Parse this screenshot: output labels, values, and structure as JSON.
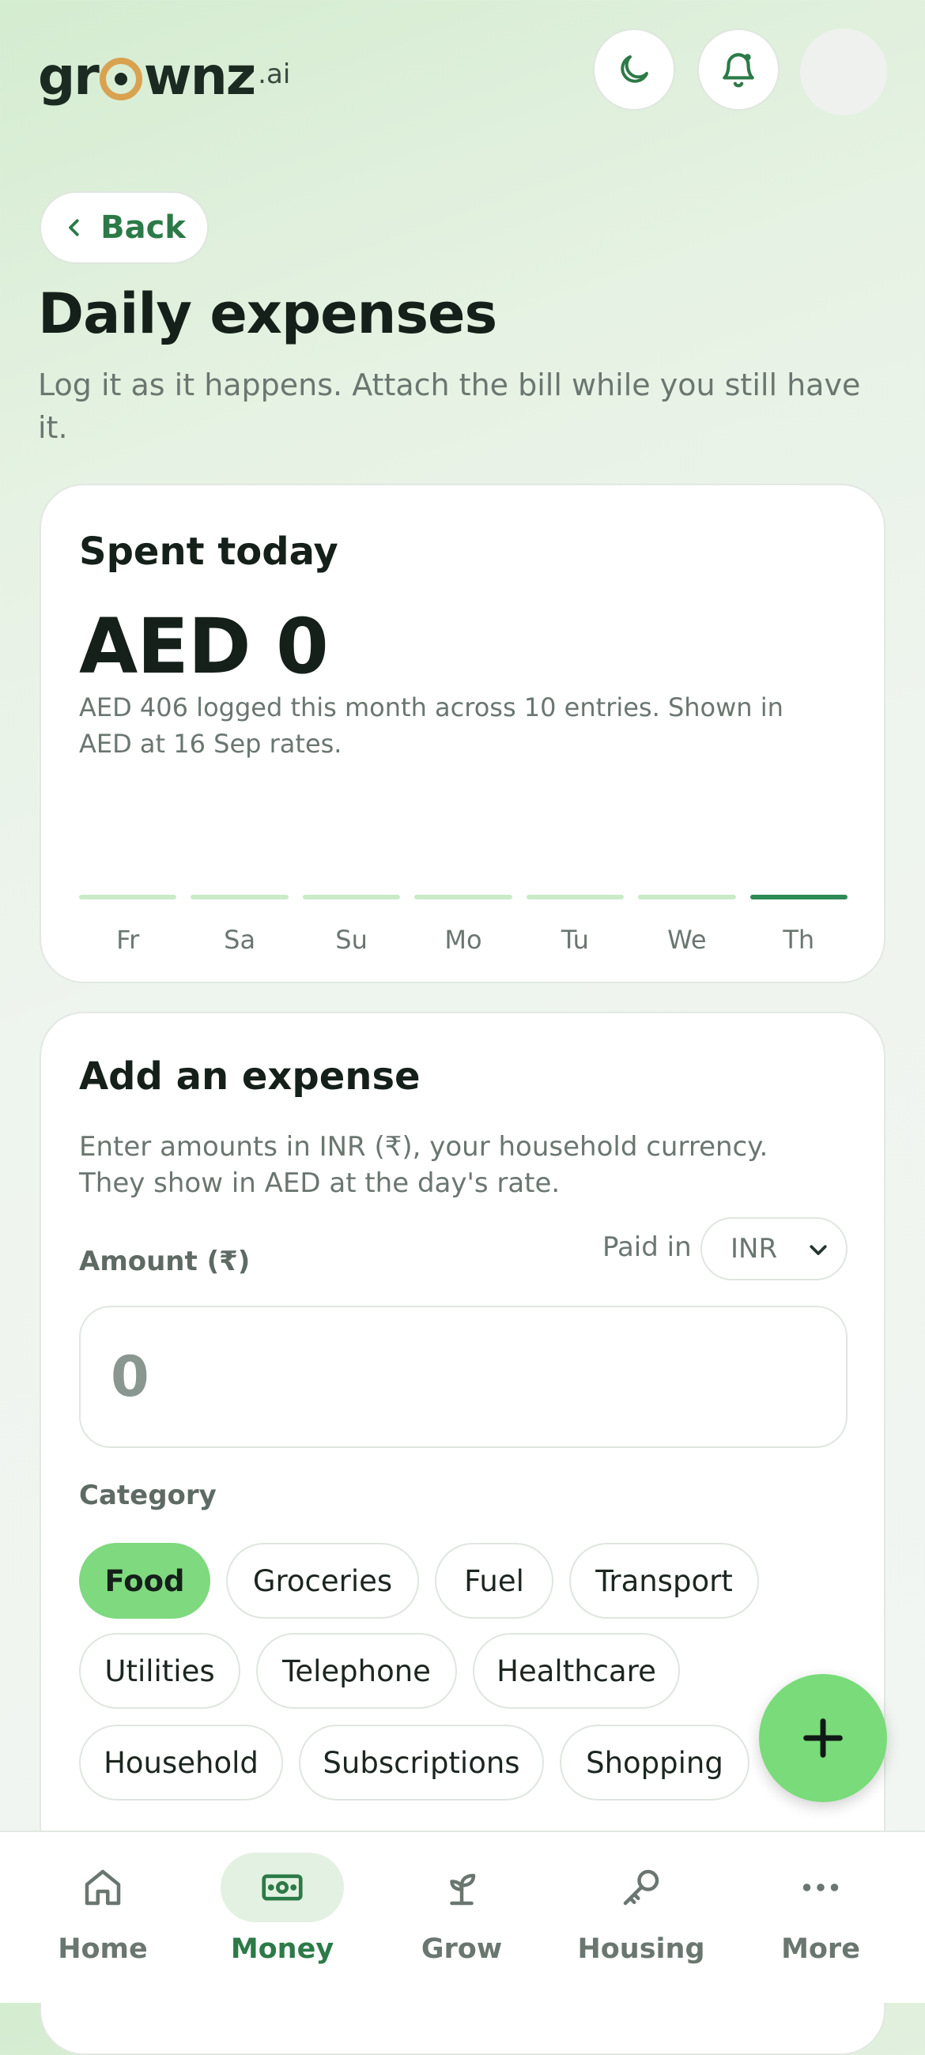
{
  "brand": {
    "name_part1": "gr",
    "name_part2": "wnz",
    "suffix": ".ai",
    "ring_color": "#d9a250"
  },
  "header": {
    "icons": [
      "moon-icon",
      "bell-icon",
      "avatar"
    ]
  },
  "back_label": "Back",
  "page": {
    "title": "Daily expenses",
    "subtitle": "Log it as it happens. Attach the bill while you still have it."
  },
  "spent_card": {
    "title": "Spent today",
    "amount": "AED 0",
    "note": "AED 406 logged this month across 10 entries. Shown in AED at 16 Sep rates.",
    "days": [
      {
        "label": "Fr",
        "active": false
      },
      {
        "label": "Sa",
        "active": false
      },
      {
        "label": "Su",
        "active": false
      },
      {
        "label": "Mo",
        "active": false
      },
      {
        "label": "Tu",
        "active": false
      },
      {
        "label": "We",
        "active": false
      },
      {
        "label": "Th",
        "active": true
      }
    ]
  },
  "add_card": {
    "title": "Add an expense",
    "note": "Enter amounts in INR (₹), your household currency. They show in AED at the day's rate.",
    "amount_label": "Amount (₹)",
    "paid_in_label": "Paid in",
    "currency": "INR",
    "amount_placeholder": "0",
    "category_label": "Category",
    "categories": [
      "Food",
      "Groceries",
      "Fuel",
      "Transport",
      "Utilities",
      "Telephone",
      "Healthcare",
      "Household",
      "Subscriptions",
      "Shopping"
    ],
    "selected_category": "Food"
  },
  "fab": {
    "icon": "plus-icon"
  },
  "tabs": [
    {
      "label": "Home",
      "icon": "home-icon",
      "active": false
    },
    {
      "label": "Money",
      "icon": "money-icon",
      "active": true
    },
    {
      "label": "Grow",
      "icon": "sprout-icon",
      "active": false
    },
    {
      "label": "Housing",
      "icon": "key-icon",
      "active": false
    },
    {
      "label": "More",
      "icon": "more-icon",
      "active": false
    }
  ],
  "colors": {
    "accent": "#2c7a47",
    "chip_selected": "#7fd97f",
    "fab": "#79db79"
  }
}
